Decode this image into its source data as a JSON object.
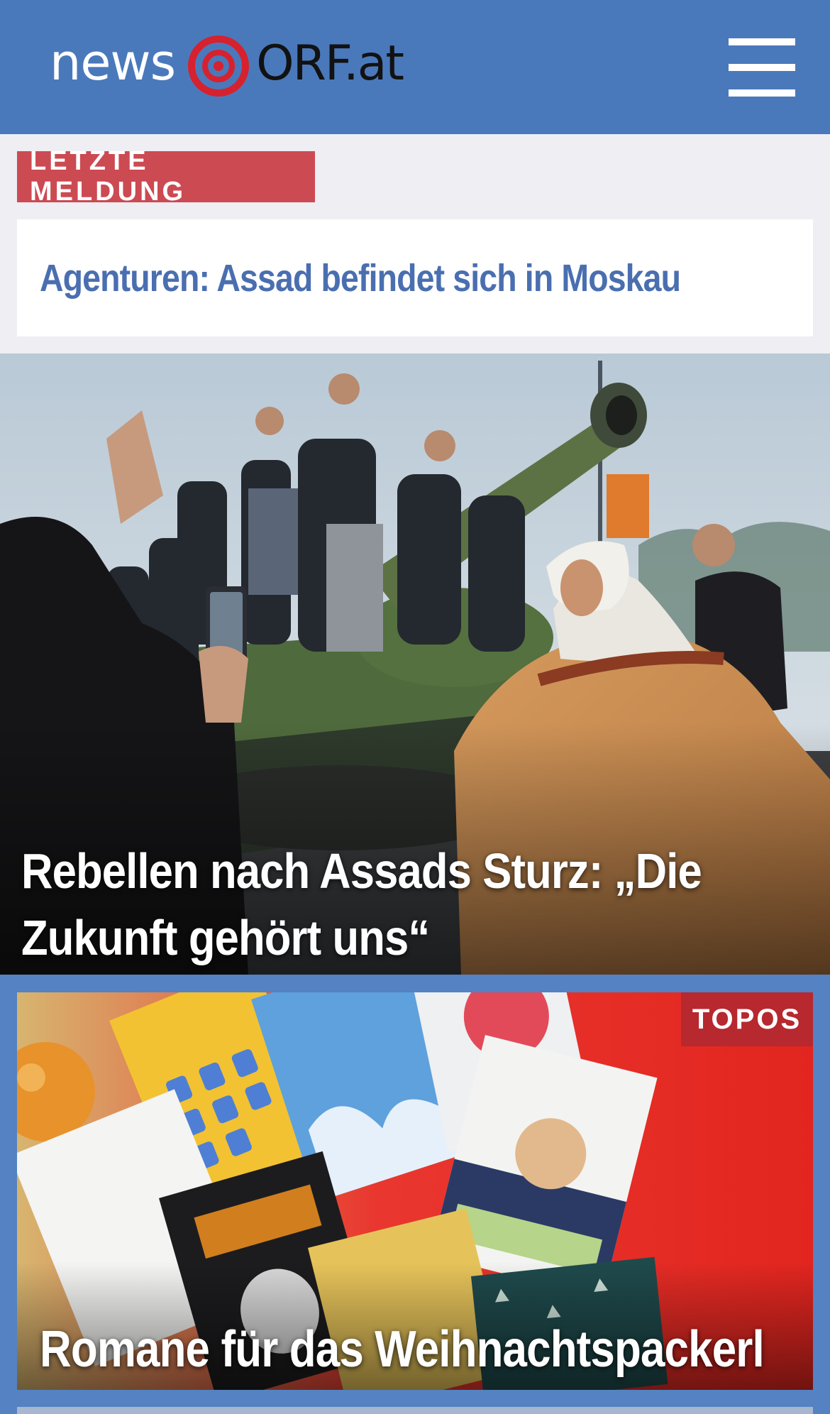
{
  "header": {
    "logo_news": "news",
    "logo_orf": "ORF.at",
    "menu_icon": "hamburger-menu-icon",
    "logo_icon": "orf-eye-icon"
  },
  "breaking": {
    "badge": "LETZTE MELDUNG",
    "title": "Agenturen: Assad befindet sich in Moskau"
  },
  "stories": [
    {
      "title": "Rebellen nach Assads Sturz: „Die Zukunft gehört uns“"
    },
    {
      "category": "TOPOS",
      "title": "Romane für das Weihnachtspackerl"
    }
  ],
  "colors": {
    "header_blue": "#4a79bb",
    "breaking_red": "#cc4a52",
    "topos_red": "#b7282f",
    "headline_blue": "#4a6fb0",
    "page_bg": "#eeeef3"
  }
}
